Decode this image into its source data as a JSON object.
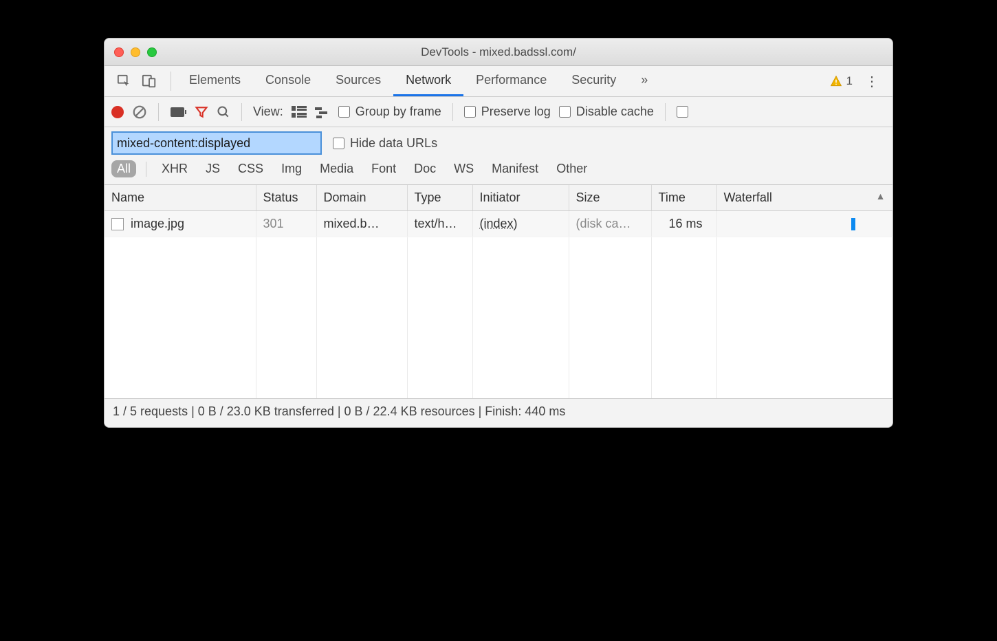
{
  "window": {
    "title": "DevTools - mixed.badssl.com/"
  },
  "tabs": {
    "items": [
      "Elements",
      "Console",
      "Sources",
      "Network",
      "Performance",
      "Security"
    ],
    "active": "Network",
    "overflow_glyph": "»",
    "warning_count": "1"
  },
  "toolbar": {
    "view_label": "View:",
    "group_by_frame": "Group by frame",
    "preserve_log": "Preserve log",
    "disable_cache": "Disable cache"
  },
  "filter": {
    "value": "mixed-content:displayed",
    "hide_data_urls": "Hide data URLs"
  },
  "types": [
    "All",
    "XHR",
    "JS",
    "CSS",
    "Img",
    "Media",
    "Font",
    "Doc",
    "WS",
    "Manifest",
    "Other"
  ],
  "types_active": "All",
  "columns": [
    "Name",
    "Status",
    "Domain",
    "Type",
    "Initiator",
    "Size",
    "Time",
    "Waterfall"
  ],
  "rows": [
    {
      "name": "image.jpg",
      "status": "301",
      "domain": "mixed.b…",
      "type": "text/h…",
      "initiator": "(index)",
      "size": "(disk ca…",
      "time": "16 ms"
    }
  ],
  "statusbar": "1 / 5 requests | 0 B / 23.0 KB transferred | 0 B / 22.4 KB resources | Finish: 440 ms"
}
